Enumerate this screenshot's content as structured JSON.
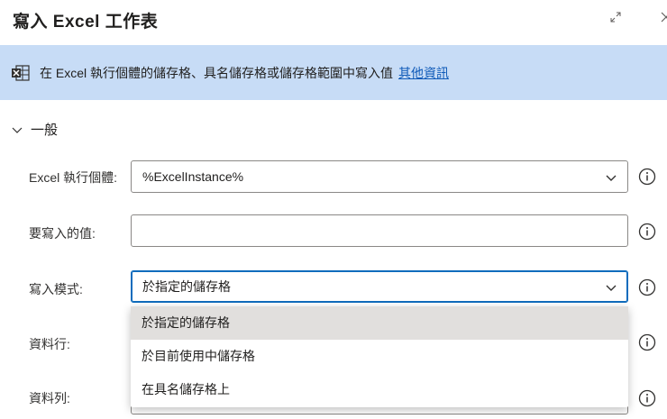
{
  "dialog": {
    "title": "寫入 Excel 工作表",
    "expand_icon": "expand-icon",
    "close_icon": "close-icon"
  },
  "banner": {
    "icon": "excel-table-icon",
    "text": "在 Excel 執行個體的儲存格、具名儲存格或儲存格範圍中寫入值",
    "link": "其他資訊",
    "background": "#c7dcf6"
  },
  "section": {
    "label": "一般",
    "state": "expanded"
  },
  "fields": {
    "instance": {
      "label": "Excel 執行個體:",
      "value": "%ExcelInstance%"
    },
    "value": {
      "label": "要寫入的值:",
      "value": ""
    },
    "mode": {
      "label": "寫入模式:",
      "value": "於指定的儲存格"
    },
    "column": {
      "label": "資料行:"
    },
    "row": {
      "label": "資料列:"
    }
  },
  "mode_options": [
    "於指定的儲存格",
    "於目前使用中儲存格",
    "在具名儲存格上"
  ],
  "colors": {
    "accent": "#0f6cbd",
    "link": "#0f5ab8",
    "selected_option": "#e1dfdd"
  }
}
